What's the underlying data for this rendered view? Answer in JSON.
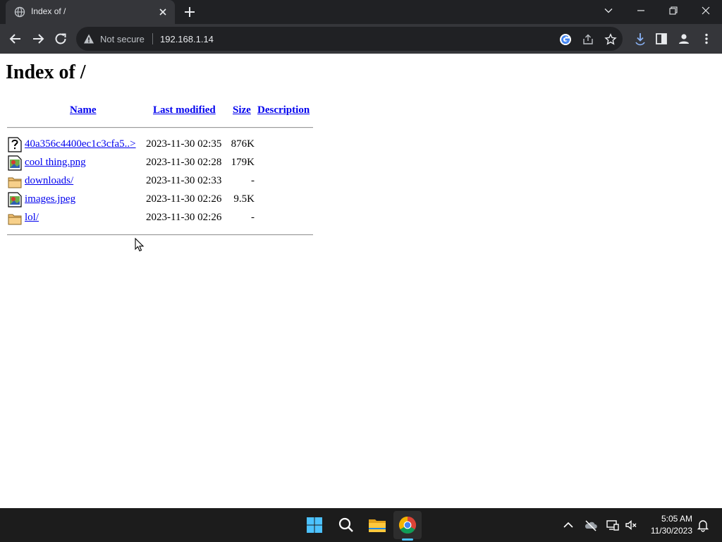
{
  "browser": {
    "tab_title": "Index of /",
    "security_label": "Not secure",
    "url": "192.168.1.14"
  },
  "page": {
    "title": "Index of /",
    "columns": {
      "name": "Name",
      "last_modified": "Last modified",
      "size": "Size",
      "description": "Description"
    },
    "files": [
      {
        "name": "40a356c4400ec1c3cfa5..>",
        "modified": "2023-11-30 02:35",
        "size": "876K",
        "icon": "unknown-file-icon"
      },
      {
        "name": "cool thing.png",
        "modified": "2023-11-30 02:28",
        "size": "179K",
        "icon": "image-file-icon"
      },
      {
        "name": "downloads/",
        "modified": "2023-11-30 02:33",
        "size": "-",
        "icon": "folder-icon"
      },
      {
        "name": "images.jpeg",
        "modified": "2023-11-30 02:26",
        "size": "9.5K",
        "icon": "image-file-icon"
      },
      {
        "name": "lol/",
        "modified": "2023-11-30 02:26",
        "size": "-",
        "icon": "folder-icon"
      }
    ]
  },
  "taskbar": {
    "time": "5:05 AM",
    "date": "11/30/2023",
    "apps": [
      "start-icon",
      "search-icon",
      "file-explorer-icon",
      "chrome-icon"
    ]
  },
  "colors": {
    "link": "#0000ee",
    "chrome_dark": "#202124",
    "chrome_toolbar": "#35363a",
    "taskbar": "#1c1c1c",
    "windows_accent": "#4cc2ff"
  }
}
